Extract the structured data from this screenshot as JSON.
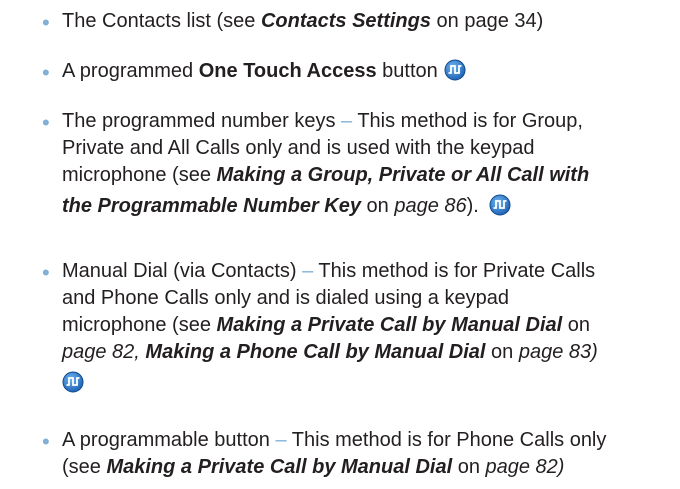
{
  "items": [
    {
      "parts": {
        "a": "The Contacts list (see ",
        "b": "Contacts Settings",
        "c": " on page 34)"
      }
    },
    {
      "parts": {
        "a": "A programmed ",
        "b": "One Touch Access",
        "c": " button"
      },
      "icon": "radio-feature-icon"
    },
    {
      "lines": {
        "l1a": "The programmed number keys ",
        "l1dash": "–",
        "l1b": " This method is for Group,",
        "l2": "Private and All Calls only and is used with the keypad",
        "l3a": "microphone (see ",
        "l3b": "Making a Group, Private or All Call with",
        "l4a": "the Programmable Number Key",
        "l4b": " on ",
        "l4c": "page 86",
        "l4d": ")."
      },
      "icon": "radio-feature-icon"
    },
    {
      "lines": {
        "l1a": "Manual Dial (via Contacts) ",
        "l1dash": "–",
        "l1b": " This method is for Private Calls",
        "l2": "and Phone Calls only and is dialed using a keypad",
        "l3a": "microphone (see ",
        "l3b": "Making a Private Call by Manual Dial",
        "l3c": " on",
        "l4a": "page 82, ",
        "l4b": "Making a Phone Call by Manual Dial",
        "l4c": " on ",
        "l4d": "page 83",
        "l4e": ")"
      },
      "icon": "radio-feature-icon"
    },
    {
      "lines": {
        "l1a": "A programmable button ",
        "l1dash": "–",
        "l1b": " This method is for Phone Calls only",
        "l2a": "(see ",
        "l2b": "Making a Private Call by Manual Dial",
        "l2c": " on ",
        "l2d": "page 82)"
      }
    }
  ],
  "bullet_char": "•",
  "colors": {
    "text": "#231f20",
    "bullet": "#80b0d8",
    "icon_blue": "#1f6fc0"
  }
}
